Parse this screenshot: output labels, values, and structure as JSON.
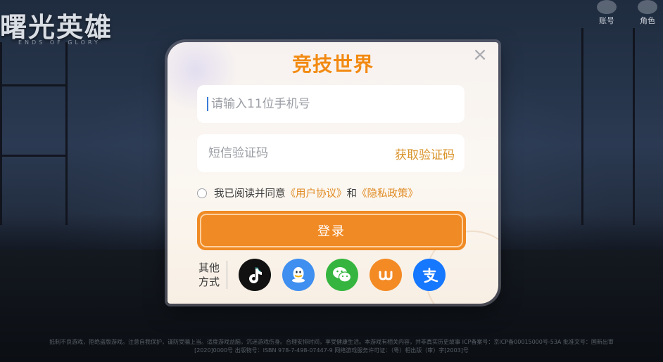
{
  "background": {
    "game_logo": "曙光英雄",
    "game_logo_sub": "ENDS OF GLORY",
    "top_right": {
      "account_label": "账号",
      "role_label": "角色"
    },
    "footer": "抵制不良游戏，拒绝盗版游戏。注意自我保护，谨防受骗上当。适度游戏益脑，沉迷游戏伤身。合理安排时间，享受健康生活。本游戏有相关内容，并非真实历史故事 ICP备案号：京ICP备00015000号-53A 批准文号：国新出审[2020]0000号 出版物号：ISBN 978-7-498-07447-9 网络游戏服务许可证：（粤）相出版（审）字[2003]号"
  },
  "dialog": {
    "title": "竞技世界",
    "close_icon": "close-icon",
    "phone_input": {
      "placeholder": "请输入11位手机号",
      "value": ""
    },
    "code_input": {
      "placeholder": "短信验证码",
      "value": ""
    },
    "get_code_label": "获取验证码",
    "agreement": {
      "prefix": "我已阅读并同意",
      "user_agreement": "《用户协议》",
      "and": "和",
      "privacy_policy": "《隐私政策》",
      "checked": false
    },
    "login_label": "登录",
    "other_methods_label": "其他方式",
    "social_logins": [
      {
        "name": "tiktok-icon",
        "color": "#111111"
      },
      {
        "name": "qq-icon",
        "color": "#3f8ff0"
      },
      {
        "name": "wechat-icon",
        "color": "#35b53f"
      },
      {
        "name": "weibo-icon",
        "color": "#f38a24"
      },
      {
        "name": "alipay-icon",
        "color": "#1677ff"
      }
    ],
    "accent_color": "#f08a24"
  }
}
